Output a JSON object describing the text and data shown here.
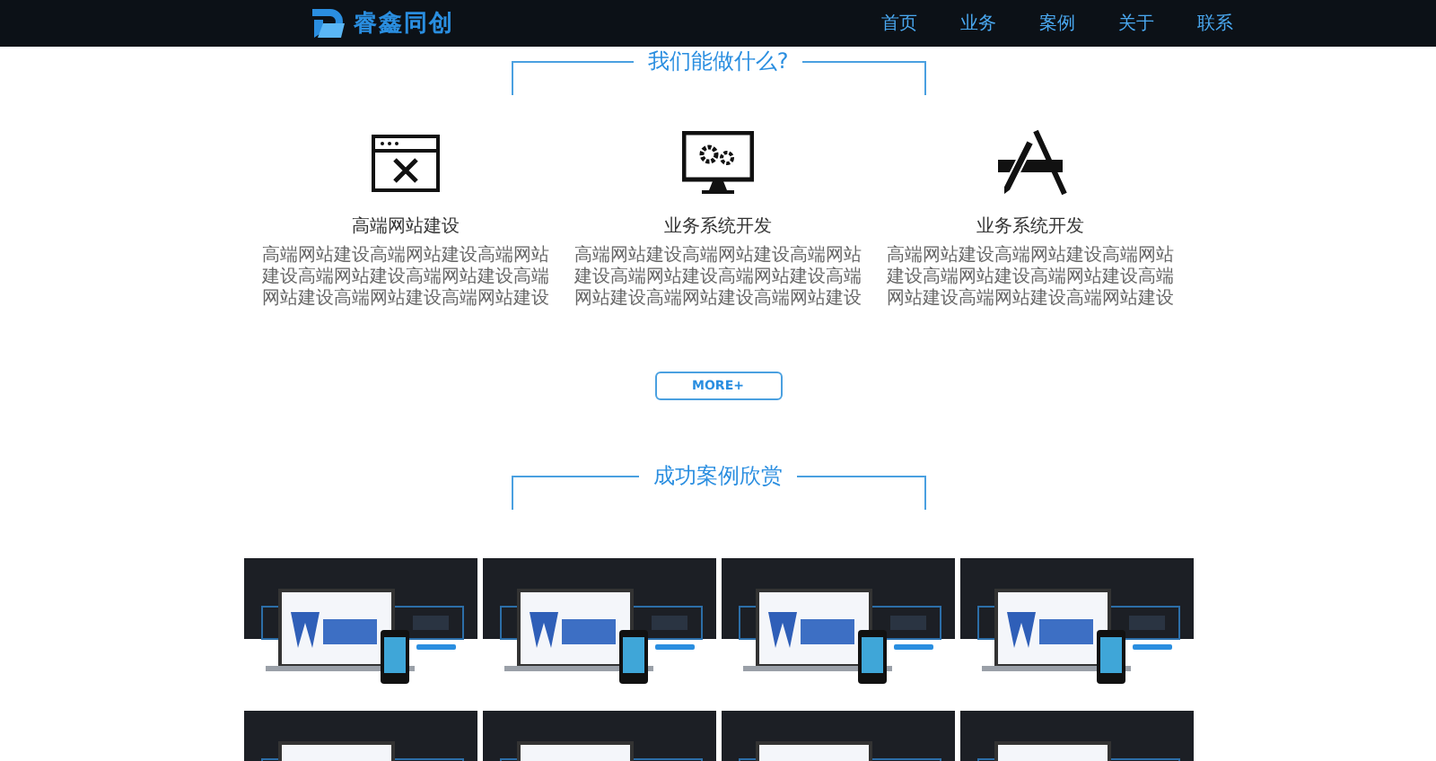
{
  "header": {
    "logo_text": "睿鑫同创",
    "nav": [
      {
        "label": "首页"
      },
      {
        "label": "业务"
      },
      {
        "label": "案例"
      },
      {
        "label": "关于"
      },
      {
        "label": "联系"
      }
    ]
  },
  "services": {
    "title": "我们能做什么?",
    "items": [
      {
        "kind": "browser-tools",
        "title": "高端网站建设",
        "text": "高端网站建设高端网站建设高端网站建设高端网站建设高端网站建设高端网站建设高端网站建设高端网站建设"
      },
      {
        "kind": "monitor-gears",
        "title": "业务系统开发",
        "text": "高端网站建设高端网站建设高端网站建设高端网站建设高端网站建设高端网站建设高端网站建设高端网站建设"
      },
      {
        "kind": "ruler-pencil",
        "title": "业务系统开发",
        "text": "高端网站建设高端网站建设高端网站建设高端网站建设高端网站建设高端网站建设高端网站建设高端网站建设"
      }
    ],
    "more_button": "MORE+"
  },
  "cases": {
    "title": "成功案例欣赏"
  }
}
